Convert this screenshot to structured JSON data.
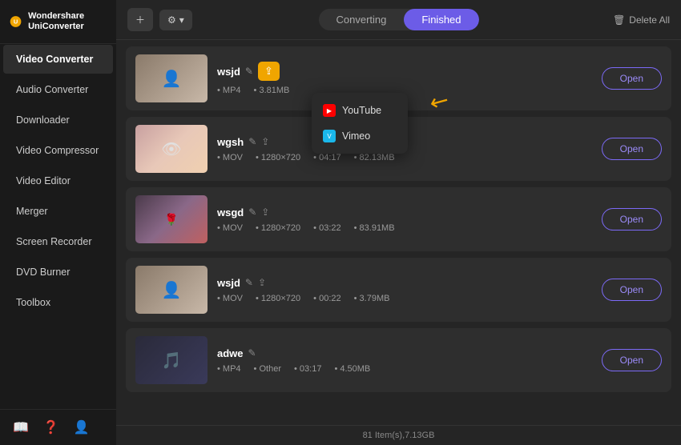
{
  "app": {
    "title": "Wondershare UniConverter"
  },
  "sidebar": {
    "active": "Video Converter",
    "items": [
      {
        "label": "Video Converter"
      },
      {
        "label": "Audio Converter"
      },
      {
        "label": "Downloader"
      },
      {
        "label": "Video Compressor"
      },
      {
        "label": "Video Editor"
      },
      {
        "label": "Merger"
      },
      {
        "label": "Screen Recorder"
      },
      {
        "label": "DVD Burner"
      },
      {
        "label": "Toolbox"
      }
    ]
  },
  "toolbar": {
    "add_label": "➕",
    "settings_label": "⚙ ▾",
    "tab_converting": "Converting",
    "tab_finished": "Finished",
    "delete_all": "Delete All"
  },
  "files": [
    {
      "name": "wsjd",
      "format": "MP4",
      "resolution": "",
      "duration": "",
      "size": "3.81MB",
      "thumb_class": "thumb-1",
      "show_share_highlight": true
    },
    {
      "name": "wgsh",
      "format": "MOV",
      "resolution": "1280×720",
      "duration": "04:17",
      "size": "82.13MB",
      "thumb_class": "thumb-2",
      "show_share_highlight": false
    },
    {
      "name": "wsgd",
      "format": "MOV",
      "resolution": "1280×720",
      "duration": "03:22",
      "size": "83.91MB",
      "thumb_class": "thumb-3",
      "show_share_highlight": false
    },
    {
      "name": "wsjd",
      "format": "MOV",
      "resolution": "1280×720",
      "duration": "00:22",
      "size": "3.79MB",
      "thumb_class": "thumb-4",
      "show_share_highlight": false
    },
    {
      "name": "adwe",
      "format": "MP4",
      "resolution": "Other",
      "duration": "03:17",
      "size": "4.50MB",
      "thumb_class": "thumb-5",
      "show_share_highlight": false
    }
  ],
  "dropdown": {
    "items": [
      {
        "label": "YouTube",
        "icon_type": "youtube"
      },
      {
        "label": "Vimeo",
        "icon_type": "vimeo"
      }
    ]
  },
  "status_bar": {
    "text": "81 Item(s),7.13GB"
  },
  "buttons": {
    "open": "Open"
  }
}
